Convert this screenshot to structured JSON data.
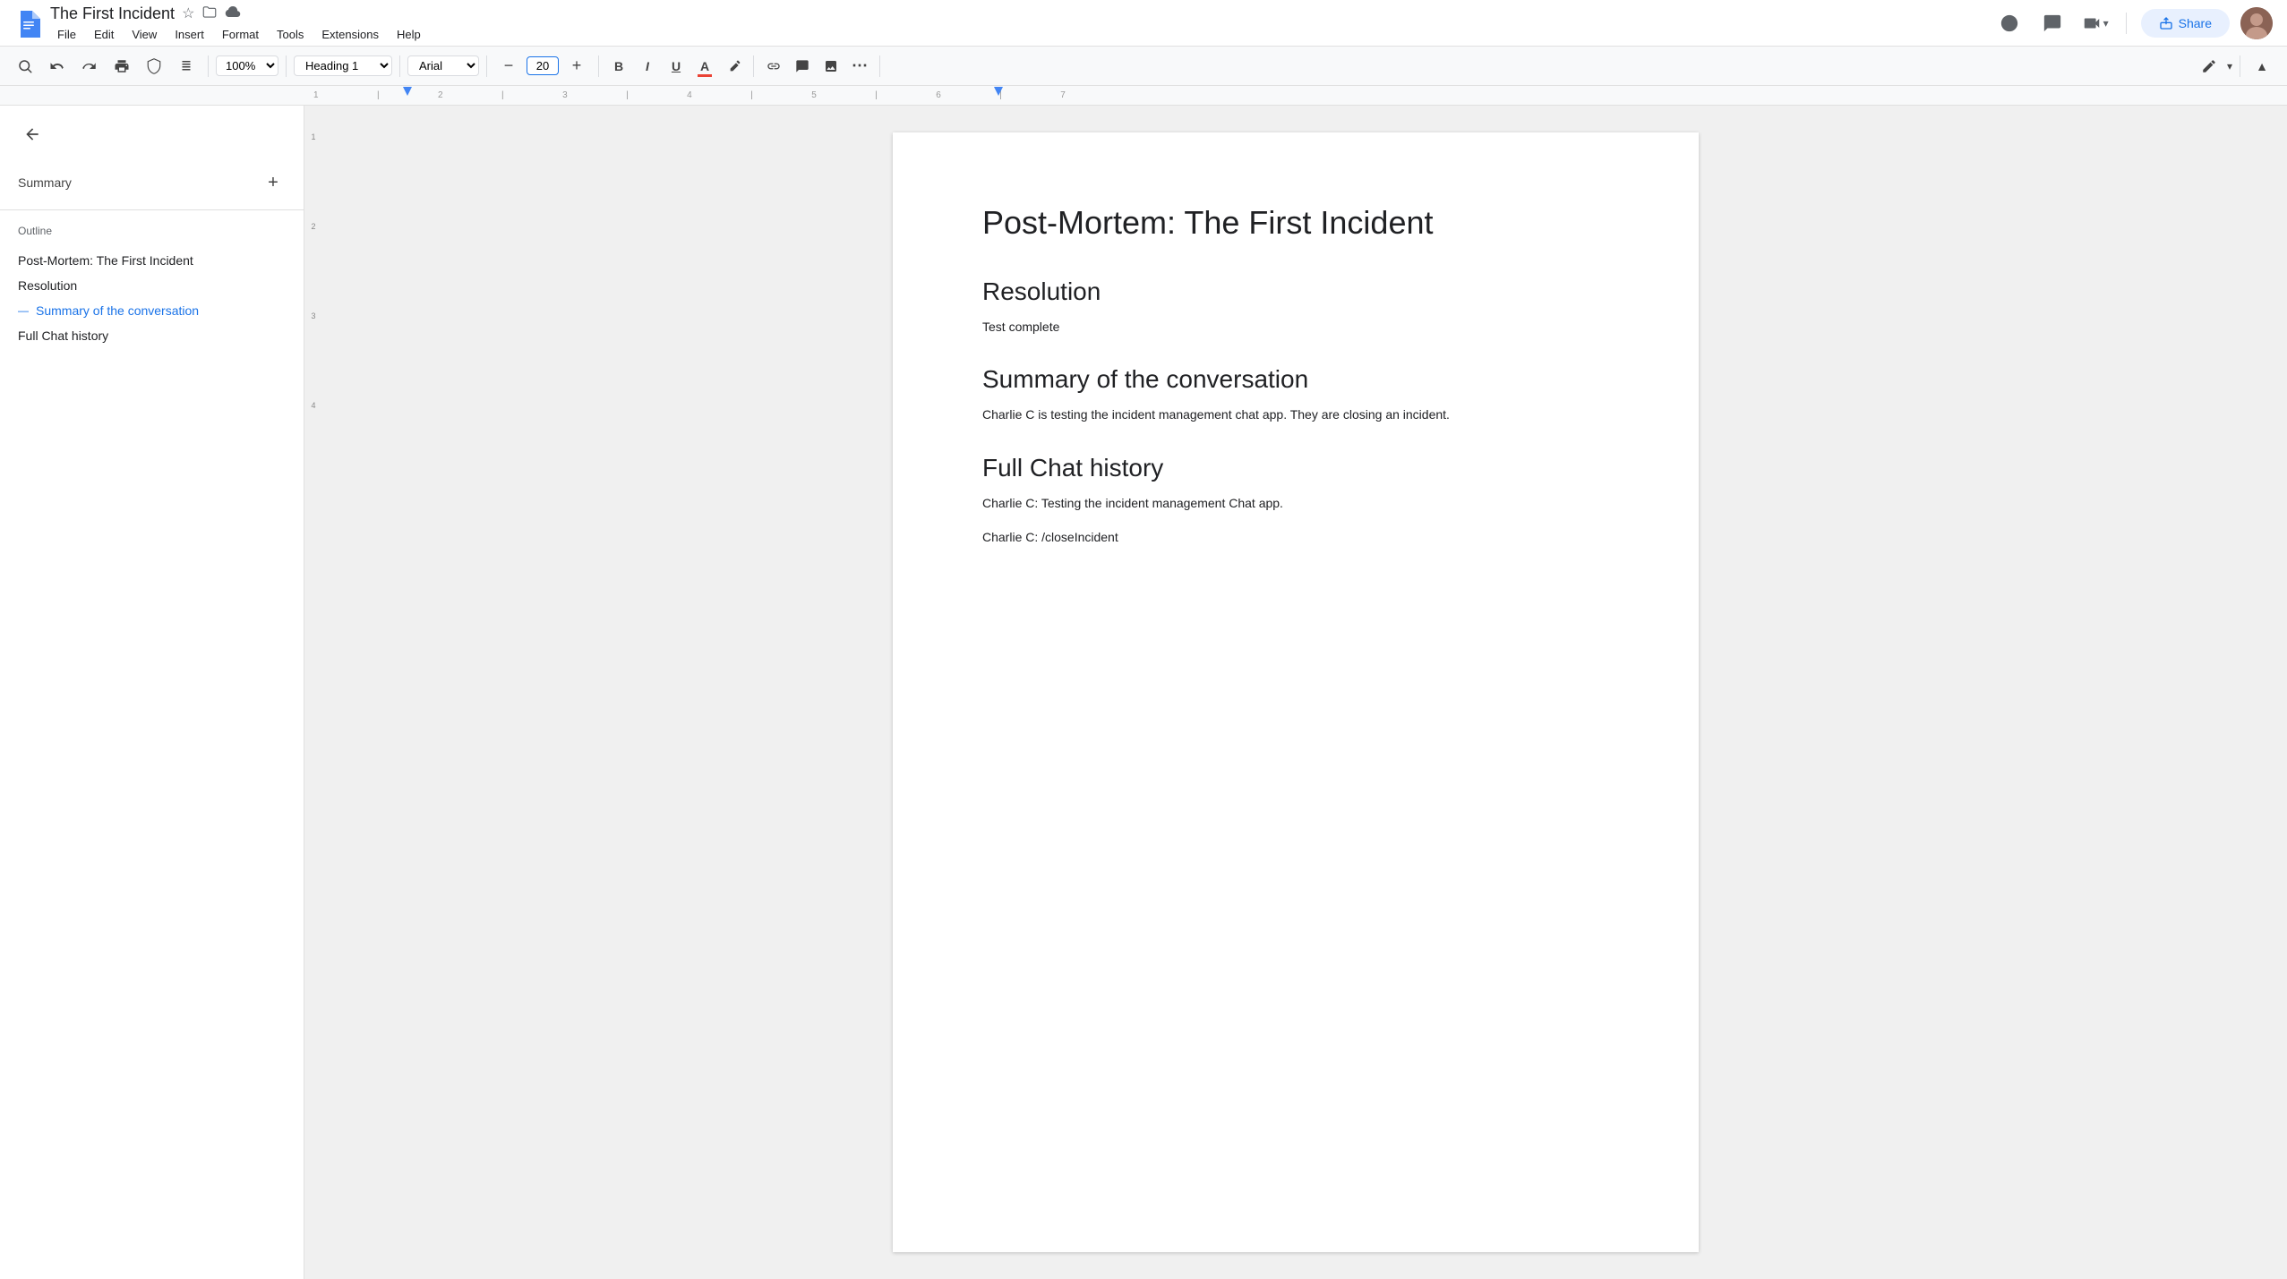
{
  "title_bar": {
    "doc_title": "The First Incident",
    "star_icon": "★",
    "folder_icon": "📁",
    "cloud_icon": "☁",
    "menu": {
      "file": "File",
      "edit": "Edit",
      "view": "View",
      "insert": "Insert",
      "format": "Format",
      "tools": "Tools",
      "extensions": "Extensions",
      "help": "Help"
    },
    "actions": {
      "history_icon": "🕐",
      "comment_icon": "💬",
      "meet_icon": "📹",
      "meet_caret": "▾",
      "share_label": "Share",
      "edit_icon": "✏",
      "caret": "▾",
      "collapse_icon": "▲"
    }
  },
  "toolbar": {
    "search_icon": "🔍",
    "undo_icon": "↩",
    "redo_icon": "↪",
    "print_icon": "🖨",
    "spellcheck_icon": "✓",
    "paint_icon": "🎨",
    "zoom_value": "100%",
    "style_value": "Heading 1",
    "font_value": "Arial",
    "font_size_value": "20",
    "decrease_font": "−",
    "increase_font": "+",
    "bold": "B",
    "italic": "I",
    "underline": "U",
    "text_color": "A",
    "highlight": "✏",
    "link": "🔗",
    "comment": "💬",
    "image": "🖼",
    "more": "⋯",
    "edit_icon2": "✏",
    "caret2": "▾",
    "collapse": "▲"
  },
  "sidebar": {
    "back_label": "←",
    "summary_label": "Summary",
    "add_label": "+",
    "outline_label": "Outline",
    "outline_items": [
      {
        "text": "Post-Mortem: The First Incident",
        "active": false
      },
      {
        "text": "Resolution",
        "active": false
      },
      {
        "text": "Summary of the conversation",
        "active": true
      },
      {
        "text": "Full Chat history",
        "active": false
      }
    ]
  },
  "document": {
    "main_title": "Post-Mortem: The First Incident",
    "sections": [
      {
        "heading": "Resolution",
        "body": "Test complete"
      },
      {
        "heading": "Summary of the conversation",
        "body": "Charlie C is testing the incident management chat app. They are closing an incident."
      },
      {
        "heading": "Full Chat history",
        "body_lines": [
          "Charlie C: Testing the incident management Chat app.",
          "Charlie C: /closeIncident"
        ]
      }
    ]
  },
  "ruler": {
    "marks": [
      "1",
      "2",
      "3",
      "4",
      "5",
      "6",
      "7"
    ]
  }
}
